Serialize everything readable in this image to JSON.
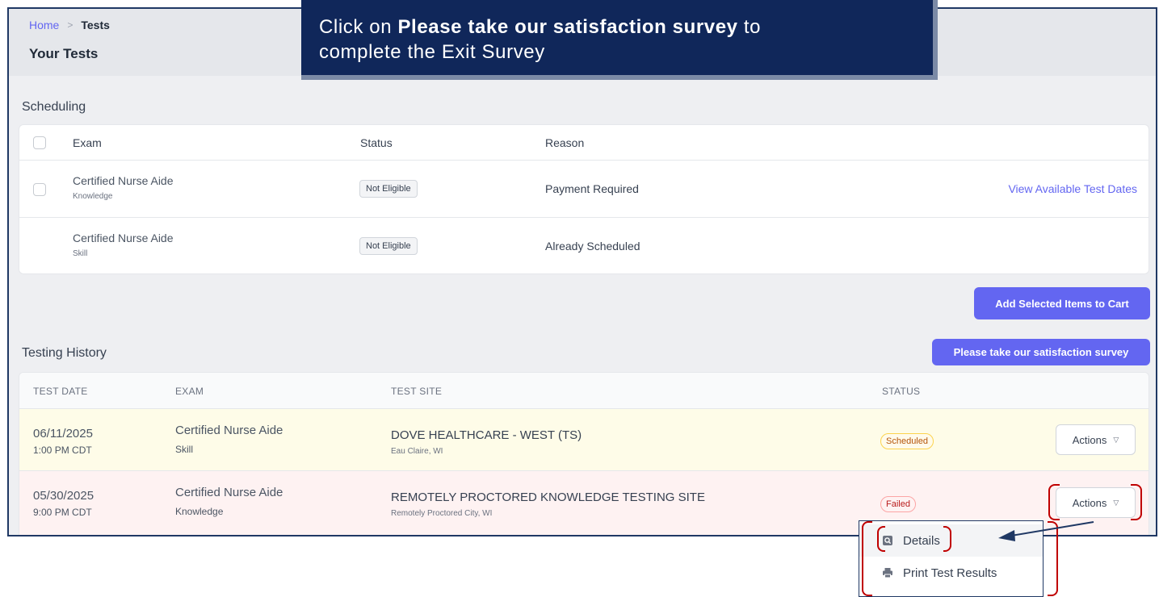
{
  "breadcrumb": {
    "home": "Home",
    "separator": ">",
    "current": "Tests"
  },
  "page_title": "Your Tests",
  "callout": {
    "prefix": "Click on ",
    "bold": "Please take our satisfaction survey",
    "suffix_line1": " to",
    "line2": "complete the Exit Survey"
  },
  "scheduling": {
    "title": "Scheduling",
    "columns": {
      "exam": "Exam",
      "status": "Status",
      "reason": "Reason"
    },
    "rows": [
      {
        "exam": "Certified Nurse Aide",
        "type": "Knowledge",
        "status": "Not Eligible",
        "reason": "Payment Required",
        "link": "View Available Test Dates"
      },
      {
        "exam": "Certified Nurse Aide",
        "type": "Skill",
        "status": "Not Eligible",
        "reason": "Already Scheduled"
      }
    ],
    "add_button": "Add Selected Items to Cart"
  },
  "history": {
    "title": "Testing History",
    "survey_button": "Please take our satisfaction survey",
    "columns": {
      "date": "TEST DATE",
      "exam": "EXAM",
      "site": "TEST SITE",
      "status": "STATUS"
    },
    "rows": [
      {
        "date": "06/11/2025",
        "time": "1:00 PM CDT",
        "exam": "Certified Nurse Aide",
        "type": "Skill",
        "site": "DOVE HEALTHCARE - WEST (TS)",
        "city": "Eau Claire, WI",
        "status": "Scheduled",
        "action": "Actions"
      },
      {
        "date": "05/30/2025",
        "time": "9:00 PM CDT",
        "exam": "Certified Nurse Aide",
        "type": "Knowledge",
        "site": "REMOTELY PROCTORED KNOWLEDGE TESTING SITE",
        "city": "Remotely Proctored City, WI",
        "status": "Failed",
        "action": "Actions"
      }
    ]
  },
  "dropdown": {
    "details": "Details",
    "print": "Print Test Results"
  },
  "icons": [
    "chevron-right-icon",
    "chevron-down-icon",
    "document-search-icon",
    "printer-icon",
    "arrow-annotation"
  ],
  "colors": {
    "accent": "#6366f1",
    "callout": "#10275a",
    "annotation": "#c00000",
    "scheduled_row": "#fefce8",
    "failed_row": "#fef2f2"
  }
}
